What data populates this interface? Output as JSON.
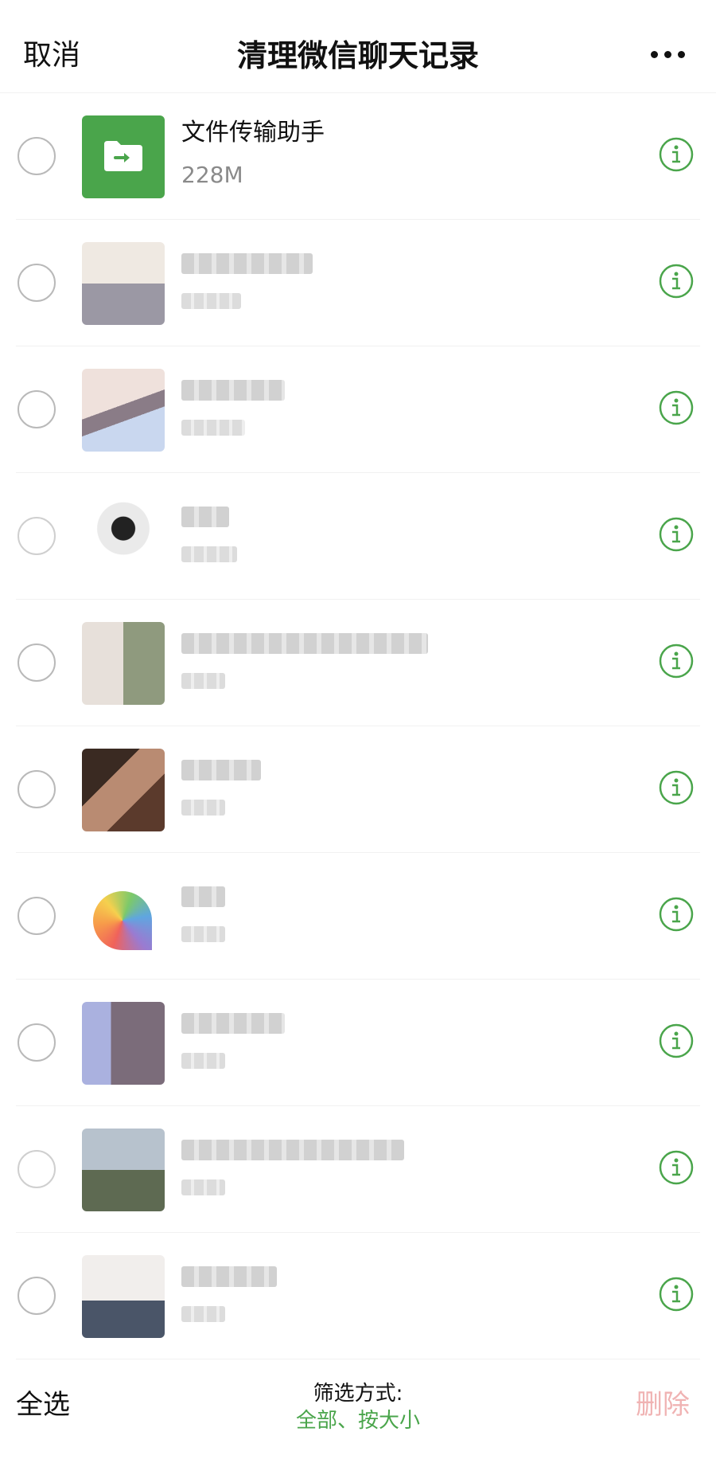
{
  "header": {
    "cancel_label": "取消",
    "title": "清理微信聊天记录",
    "more_icon": "more-horizontal-icon"
  },
  "accent_color": "#4aa54b",
  "chats": [
    {
      "name": "文件传输助手",
      "size": "228M",
      "avatar": "folder-transfer-icon"
    },
    {
      "name": "",
      "size": "",
      "avatar": "blurred-group-avatar"
    },
    {
      "name": "",
      "size": "",
      "avatar": "blurred-group-avatar"
    },
    {
      "name": "",
      "size": "",
      "avatar": "blurred-avatar"
    },
    {
      "name": "",
      "size": "",
      "avatar": "blurred-group-avatar"
    },
    {
      "name": "",
      "size": "",
      "avatar": "blurred-photo-avatar"
    },
    {
      "name": "",
      "size": "",
      "avatar": "rainbow-avatar"
    },
    {
      "name": "",
      "size": "",
      "avatar": "blurred-avatar"
    },
    {
      "name": "",
      "size": "",
      "avatar": "blurred-group-avatar"
    },
    {
      "name": "",
      "size": "",
      "avatar": "blurred-group-avatar"
    }
  ],
  "footer": {
    "select_all_label": "全选",
    "filter_label": "筛选方式:",
    "filter_value": "全部、按大小",
    "delete_label": "删除"
  }
}
